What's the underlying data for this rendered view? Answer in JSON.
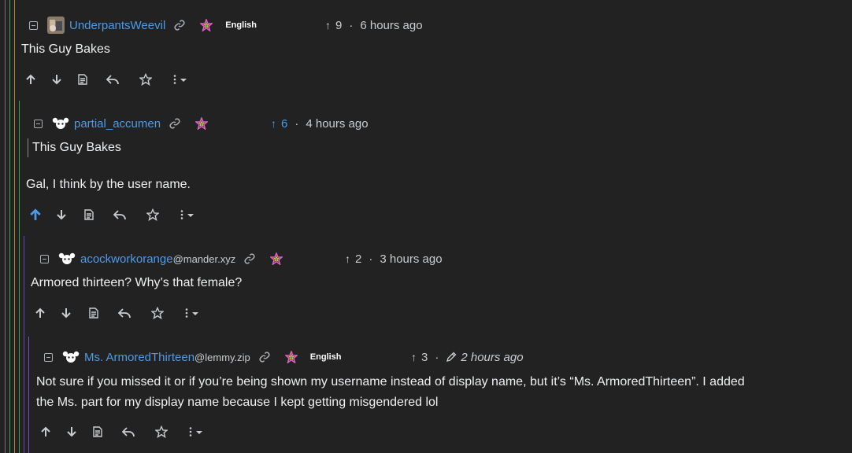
{
  "comments": [
    {
      "username": "UnderpantsWeevil",
      "instance": "",
      "language": "English",
      "score": "9",
      "time": "6 hours ago",
      "edited": false,
      "upvoted": false,
      "quote": "",
      "text": "This Guy Bakes",
      "avatar_icon": "avatar-image-icon"
    },
    {
      "username": "partial_accumen",
      "instance": "",
      "language": "",
      "score": "6",
      "time": "4 hours ago",
      "edited": false,
      "upvoted": true,
      "quote": "This Guy Bakes",
      "text": "Gal, I think by the user name.",
      "avatar_icon": "default-avatar-icon"
    },
    {
      "username": "acockworkorange",
      "instance": "@mander.xyz",
      "language": "",
      "score": "2",
      "time": "3 hours ago",
      "edited": false,
      "upvoted": false,
      "quote": "",
      "text": "Armored thirteen? Why’s that female?",
      "avatar_icon": "default-avatar-icon"
    },
    {
      "username": "Ms. ArmoredThirteen",
      "instance": "@lemmy.zip",
      "language": "English",
      "score": "3",
      "time": "2 hours ago",
      "edited": true,
      "upvoted": false,
      "quote": "",
      "text_line1": "Not sure if you missed it or if you’re being shown my username instead of display name, but it’s “Ms. ArmoredThirteen”. I added",
      "text_line2": "the Ms. part for my display name because I kept getting misgendered lol",
      "avatar_icon": "default-avatar-icon"
    }
  ],
  "colors": {
    "background": "#222222",
    "link": "#4c9be8",
    "text": "#eef0f2",
    "muted": "#c9cdd1",
    "rails": [
      "#6c757d",
      "#3fa34d",
      "#6f42c1",
      "#7952b3"
    ]
  },
  "icons": {
    "upvote": "arrow-up-icon",
    "downvote": "arrow-down-icon",
    "source": "document-icon",
    "reply": "reply-icon",
    "save": "star-icon",
    "more": "more-vertical-icon",
    "link": "link-icon",
    "flair": "rainbow-star-icon",
    "collapse": "minus-square-icon",
    "edited": "pencil-icon"
  }
}
